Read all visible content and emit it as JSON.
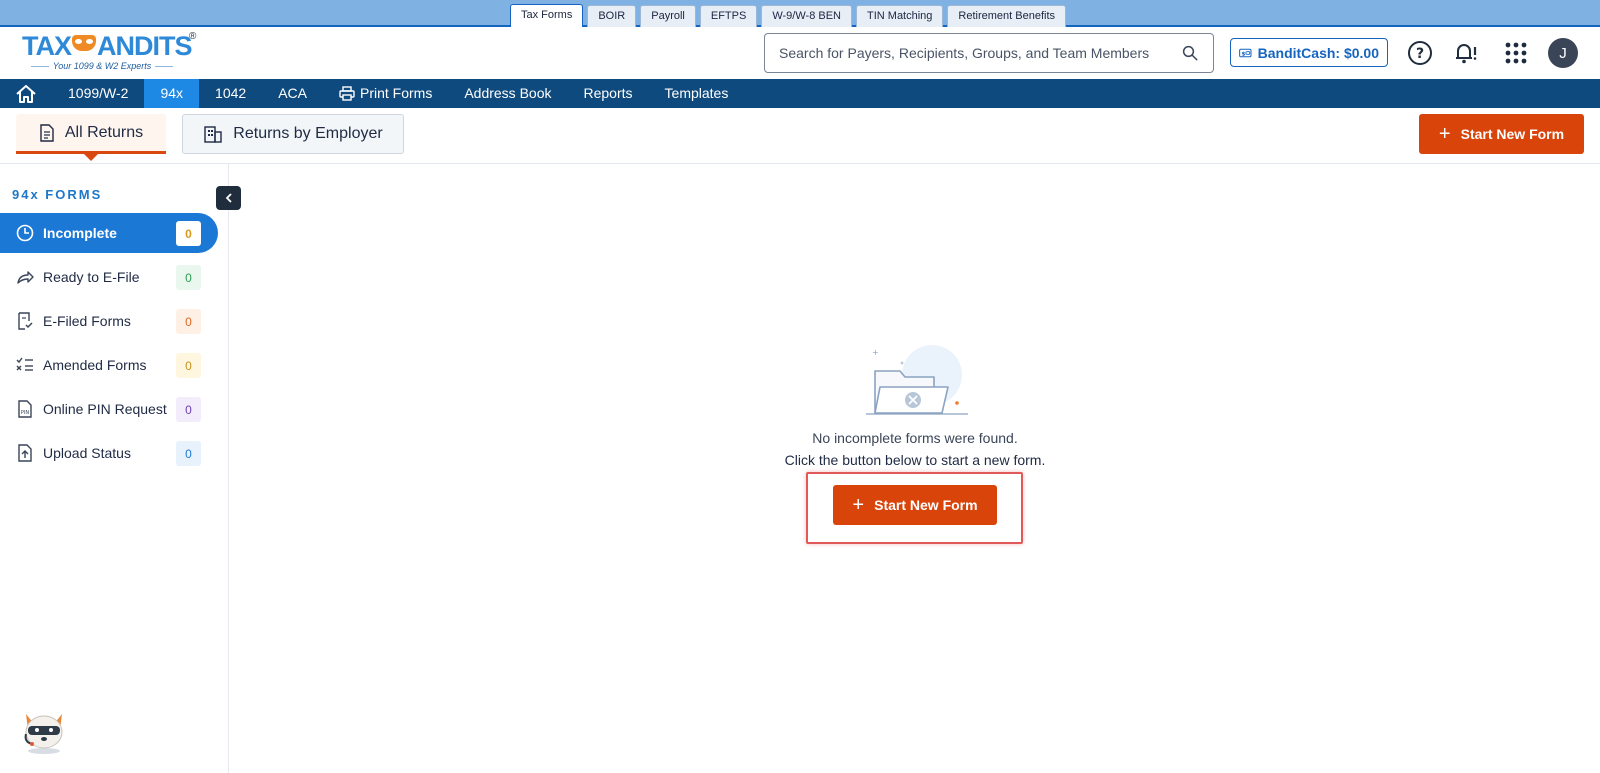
{
  "product_tabs": [
    "Tax Forms",
    "BOIR",
    "Payroll",
    "EFTPS",
    "W-9/W-8 BEN",
    "TIN Matching",
    "Retirement Benefits"
  ],
  "product_tabs_active": "Tax Forms",
  "logo": {
    "text_left": "TAX",
    "text_right": "ANDITS",
    "reg": "®",
    "tagline": "Your 1099 & W2 Experts"
  },
  "search": {
    "placeholder": "Search for Payers, Recipients, Groups, and Team Members"
  },
  "bandit_cash": {
    "label": "BanditCash: $0.00"
  },
  "user": {
    "initial": "J"
  },
  "nav": {
    "items": [
      "1099/W-2",
      "94x",
      "1042",
      "ACA",
      "Print Forms",
      "Address Book",
      "Reports",
      "Templates"
    ],
    "active": "94x"
  },
  "subheader": {
    "all_returns": "All Returns",
    "returns_by_employer": "Returns by Employer",
    "start_new_form": "Start New Form"
  },
  "sidebar": {
    "title": "94x FORMS",
    "items": [
      {
        "label": "Incomplete",
        "count": "0",
        "color": "#d99a1a",
        "bg": "#ffffff"
      },
      {
        "label": "Ready to E-File",
        "count": "0",
        "color": "#2e9d52",
        "bg": "#e9f7ee"
      },
      {
        "label": "E-Filed Forms",
        "count": "0",
        "color": "#e0661f",
        "bg": "#fff0e6"
      },
      {
        "label": "Amended Forms",
        "count": "0",
        "color": "#c9921a",
        "bg": "#fff6e0"
      },
      {
        "label": "Online PIN Request",
        "count": "0",
        "color": "#6a3fb2",
        "bg": "#f3ecfb"
      },
      {
        "label": "Upload Status",
        "count": "0",
        "color": "#1b78d4",
        "bg": "#e8f2fc"
      }
    ]
  },
  "empty_state": {
    "line1": "No incomplete forms were found.",
    "line2": "Click the button below to start a new form.",
    "button": "Start New Form"
  },
  "colors": {
    "accent": "#d9440a",
    "nav": "#0f4a7e",
    "active_blue": "#1b78d4"
  }
}
